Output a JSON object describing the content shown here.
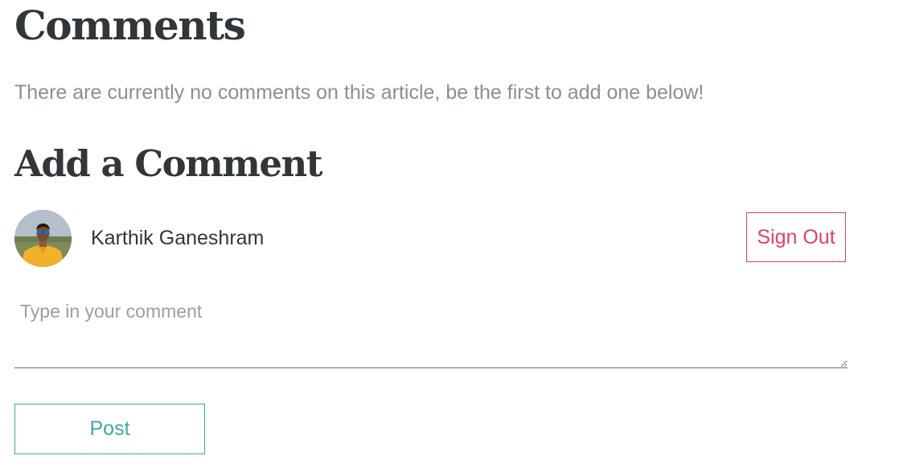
{
  "comments_section": {
    "title": "Comments",
    "empty_message": "There are currently no comments on this article, be the first to add one below!"
  },
  "add_comment": {
    "title": "Add a Comment",
    "user": {
      "name": "Karthik Ganeshram",
      "avatar_icon": "user-avatar-photo"
    },
    "sign_out_label": "Sign Out",
    "comment_field": {
      "placeholder": "Type in your comment",
      "value": ""
    },
    "post_label": "Post"
  },
  "colors": {
    "heading": "#333638",
    "muted_text": "#8a8f94",
    "sign_out_accent": "#e23e6d",
    "post_accent": "#3aaa9f"
  }
}
